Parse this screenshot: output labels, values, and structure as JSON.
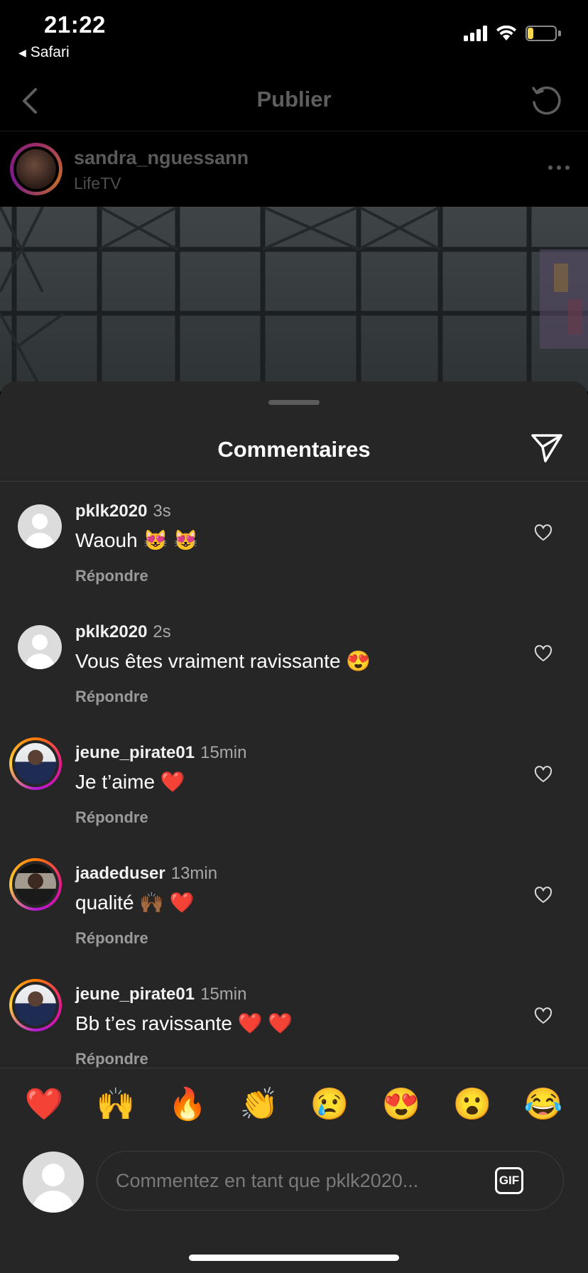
{
  "status_bar": {
    "time": "21:22",
    "back_app": "Safari",
    "battery_percent": "17"
  },
  "nav": {
    "title": "Publier",
    "back_icon": "chevron-left-icon",
    "refresh_icon": "refresh-icon"
  },
  "post": {
    "username": "sandra_nguessann",
    "subtitle": "LifeTV"
  },
  "sheet": {
    "title": "Commentaires",
    "share_icon": "send-icon"
  },
  "comments": [
    {
      "user": "pklk2020",
      "time": "3s",
      "text": "Waouh 😻 😻",
      "reply": "Répondre",
      "avatar": "default"
    },
    {
      "user": "pklk2020",
      "time": "2s",
      "text": "Vous êtes vraiment ravissante 😍",
      "reply": "Répondre",
      "avatar": "default"
    },
    {
      "user": "jeune_pirate01",
      "time": "15min",
      "text": "Je t’aime ❤️",
      "reply": "Répondre",
      "avatar": "story-ring"
    },
    {
      "user": "jaadeduser",
      "time": "13min",
      "text": "qualité 🙌🏾 ❤️",
      "reply": "Répondre",
      "avatar": "story-ring"
    },
    {
      "user": "jeune_pirate01",
      "time": "15min",
      "text": "Bb t’es ravissante ❤️ ❤️",
      "reply": "Répondre",
      "avatar": "story-ring"
    }
  ],
  "quick_reactions": [
    "❤️",
    "🙌",
    "🔥",
    "👏",
    "😢",
    "😍",
    "😮",
    "😂"
  ],
  "compose": {
    "placeholder": "Commentez en tant que pklk2020...",
    "gif_label": "GIF"
  },
  "colors": {
    "sheet_bg": "#262626",
    "background": "#000000",
    "muted_text": "#a8a8a8"
  }
}
